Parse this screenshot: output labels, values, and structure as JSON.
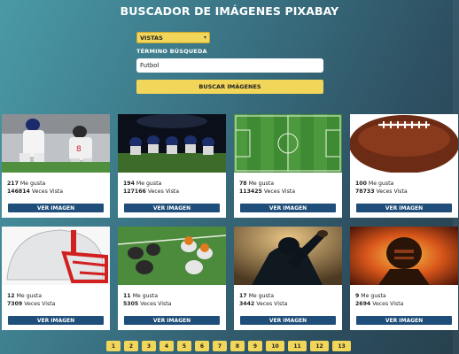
{
  "header": {
    "title": "BUSCADOR DE IMÁGENES PIXABAY"
  },
  "form": {
    "category_select": "VISTAS",
    "search_label": "TÉRMINO BÚSQUEDA",
    "search_value": "Futbol",
    "search_button": "BUSCAR IMÁGENES"
  },
  "results": [
    {
      "likes": "217",
      "likes_label": "Me gusta",
      "views": "146814",
      "views_label": "Veces Vista",
      "button": "VER IMAGEN",
      "image": "football-players-white-jerseys-image"
    },
    {
      "likes": "194",
      "likes_label": "Me gusta",
      "views": "127166",
      "views_label": "Veces Vista",
      "button": "VER IMAGEN",
      "image": "football-line-stadium-night-image"
    },
    {
      "likes": "78",
      "likes_label": "Me gusta",
      "views": "113425",
      "views_label": "Veces Vista",
      "button": "VER IMAGEN",
      "image": "soccer-field-aerial-image"
    },
    {
      "likes": "100",
      "likes_label": "Me gusta",
      "views": "78733",
      "views_label": "Veces Vista",
      "button": "VER IMAGEN",
      "image": "american-football-ball-image"
    },
    {
      "likes": "12",
      "likes_label": "Me gusta",
      "views": "7309",
      "views_label": "Veces Vista",
      "button": "VER IMAGEN",
      "image": "football-helmet-red-image"
    },
    {
      "likes": "11",
      "likes_label": "Me gusta",
      "views": "5305",
      "views_label": "Veces Vista",
      "button": "VER IMAGEN",
      "image": "football-scrimmage-field-image"
    },
    {
      "likes": "17",
      "likes_label": "Me gusta",
      "views": "3442",
      "views_label": "Veces Vista",
      "button": "VER IMAGEN",
      "image": "football-player-silhouette-image"
    },
    {
      "likes": "9",
      "likes_label": "Me gusta",
      "views": "2694",
      "views_label": "Veces Vista",
      "button": "VER IMAGEN",
      "image": "football-player-fire-image"
    }
  ],
  "pagination": [
    "1",
    "2",
    "3",
    "4",
    "5",
    "6",
    "7",
    "8",
    "9",
    "10",
    "11",
    "12",
    "13"
  ],
  "colors": {
    "accent": "#f2d65a",
    "button": "#1f4e7a"
  }
}
